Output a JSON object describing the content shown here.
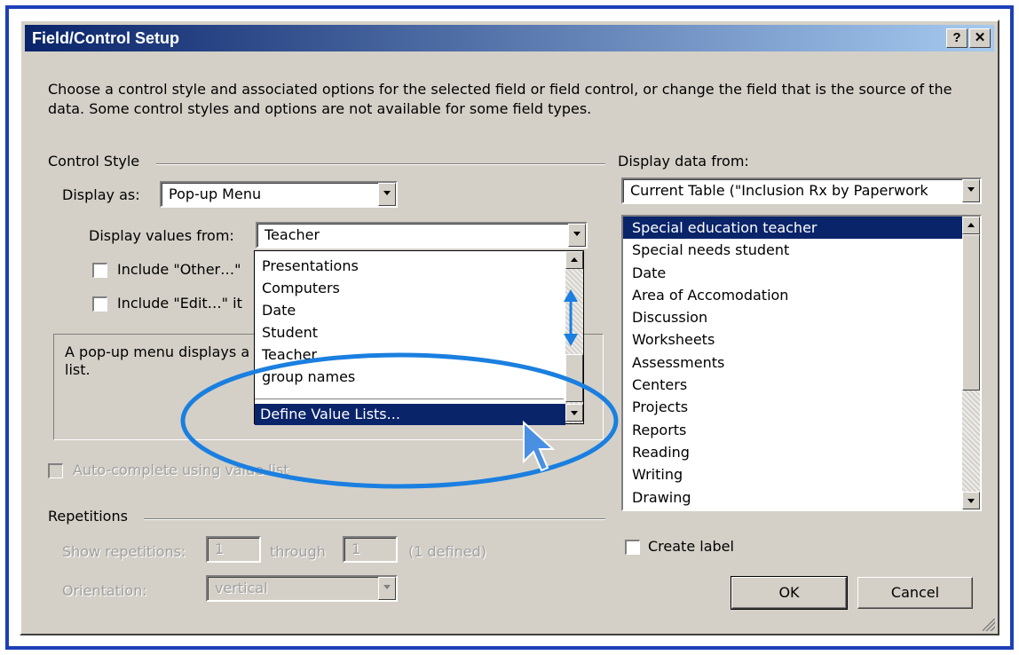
{
  "dialog": {
    "title": "Field/Control Setup",
    "help_label": "?",
    "close_label": "✕",
    "description": "Choose a control style and associated options for the selected field or field control, or change the field that is the source of the data. Some control styles and options are not available for some field types."
  },
  "control_style": {
    "group_label": "Control Style",
    "display_as_label": "Display as:",
    "display_as_value": "Pop-up Menu",
    "values_from_label": "Display values from:",
    "values_from_value": "Teacher",
    "include_other_label": "Include \"Other…\"",
    "include_edit_label": "Include \"Edit…\" it",
    "info_text": "A pop-up menu displays a the list.",
    "autocomplete_label": "Auto-complete using value list"
  },
  "value_list_popup": {
    "items": [
      "Presentations",
      "Computers",
      "Date",
      "Student",
      "Teacher",
      "group names"
    ],
    "define_label": "Define Value Lists..."
  },
  "repetitions": {
    "group_label": "Repetitions",
    "show_label": "Show repetitions:",
    "from_value": "1",
    "through_label": "through",
    "to_value": "1",
    "defined_text": "(1 defined)",
    "orientation_label": "Orientation:",
    "orientation_value": "vertical"
  },
  "display_data": {
    "label": "Display data from:",
    "table_value": "Current Table (\"Inclusion Rx by Paperwork",
    "fields": [
      "Special education teacher",
      "Special needs student",
      "Date",
      "Area of Accomodation",
      "Discussion",
      "Worksheets",
      "Assessments",
      "Centers",
      "Projects",
      "Reports",
      "Reading",
      "Writing",
      "Drawing"
    ],
    "selected_index": 0,
    "create_label": "Create label"
  },
  "buttons": {
    "ok": "OK",
    "cancel": "Cancel"
  },
  "colors": {
    "frame": "#1c3fb8",
    "highlight": "#0a246a",
    "annotation": "#1a7fe0"
  }
}
